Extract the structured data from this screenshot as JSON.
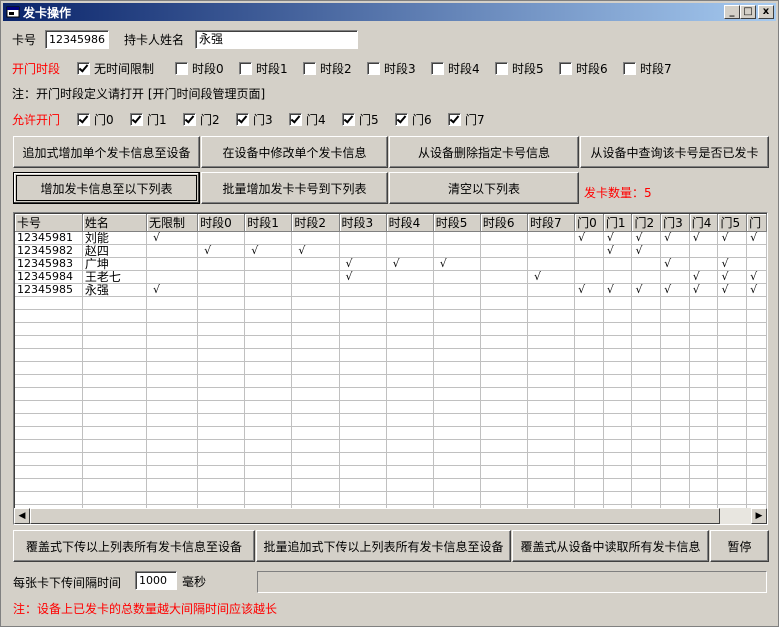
{
  "window": {
    "title": "发卡操作",
    "controls": {
      "minimize": "_",
      "maximize": "□",
      "close": "x"
    }
  },
  "form": {
    "card_no_label": "卡号",
    "card_no_value": "12345986",
    "holder_label": "持卡人姓名",
    "holder_value": "永强",
    "time_label": "开门时段",
    "time_options": [
      {
        "label": "无时间限制",
        "checked": true
      },
      {
        "label": "时段0",
        "checked": false
      },
      {
        "label": "时段1",
        "checked": false
      },
      {
        "label": "时段2",
        "checked": false
      },
      {
        "label": "时段3",
        "checked": false
      },
      {
        "label": "时段4",
        "checked": false
      },
      {
        "label": "时段5",
        "checked": false
      },
      {
        "label": "时段6",
        "checked": false
      },
      {
        "label": "时段7",
        "checked": false
      }
    ],
    "note_time": "注：开门时段定义请打开  [开门时间段管理页面]",
    "door_label": "允许开门",
    "doors": [
      {
        "label": "门0",
        "checked": true
      },
      {
        "label": "门1",
        "checked": true
      },
      {
        "label": "门2",
        "checked": true
      },
      {
        "label": "门3",
        "checked": true
      },
      {
        "label": "门4",
        "checked": true
      },
      {
        "label": "门5",
        "checked": true
      },
      {
        "label": "门6",
        "checked": true
      },
      {
        "label": "门7",
        "checked": true
      }
    ]
  },
  "buttons": {
    "append_single": "追加式增加单个发卡信息至设备",
    "modify_single": "在设备中修改单个发卡信息",
    "delete_card": "从设备删除指定卡号信息",
    "query_card": "从设备中查询该卡号是否已发卡",
    "add_to_list": "增加发卡信息至以下列表",
    "batch_add": "批量增加发卡卡号到下列表",
    "clear_list": "清空以下列表",
    "overwrite_upload": "覆盖式下传以上列表所有发卡信息至设备",
    "batch_append_upload": "批量追加式下传以上列表所有发卡信息至设备",
    "overwrite_read": "覆盖式从设备中读取所有发卡信息",
    "pause": "暂停"
  },
  "card_count": "发卡数量：5",
  "table": {
    "columns": [
      "卡号",
      "姓名",
      "无限制",
      "时段0",
      "时段1",
      "时段2",
      "时段3",
      "时段4",
      "时段5",
      "时段6",
      "时段7",
      "门0",
      "门1",
      "门2",
      "门3",
      "门4",
      "门5",
      "门"
    ],
    "check_mark": "√",
    "rows": [
      {
        "card": "12345981",
        "name": "刘能",
        "checks": [
          1,
          0,
          0,
          0,
          0,
          0,
          0,
          0,
          0,
          1,
          1,
          1,
          1,
          1,
          1,
          1
        ]
      },
      {
        "card": "12345982",
        "name": "赵四",
        "checks": [
          0,
          1,
          1,
          1,
          0,
          0,
          0,
          0,
          0,
          0,
          1,
          1,
          0,
          0,
          0,
          0
        ]
      },
      {
        "card": "12345983",
        "name": "广坤",
        "checks": [
          0,
          0,
          0,
          0,
          1,
          1,
          1,
          0,
          0,
          0,
          0,
          0,
          1,
          0,
          1,
          0
        ]
      },
      {
        "card": "12345984",
        "name": "王老七",
        "checks": [
          0,
          0,
          0,
          0,
          1,
          0,
          0,
          0,
          1,
          0,
          0,
          0,
          0,
          1,
          1,
          1
        ]
      },
      {
        "card": "12345985",
        "name": "永强",
        "checks": [
          1,
          0,
          0,
          0,
          0,
          0,
          0,
          0,
          0,
          1,
          1,
          1,
          1,
          1,
          1,
          1
        ]
      }
    ]
  },
  "interval": {
    "label": "每张卡下传间隔时间",
    "value": "1000",
    "unit": "毫秒"
  },
  "bottom_note": "注：设备上已发卡的总数量越大间隔时间应该越长"
}
